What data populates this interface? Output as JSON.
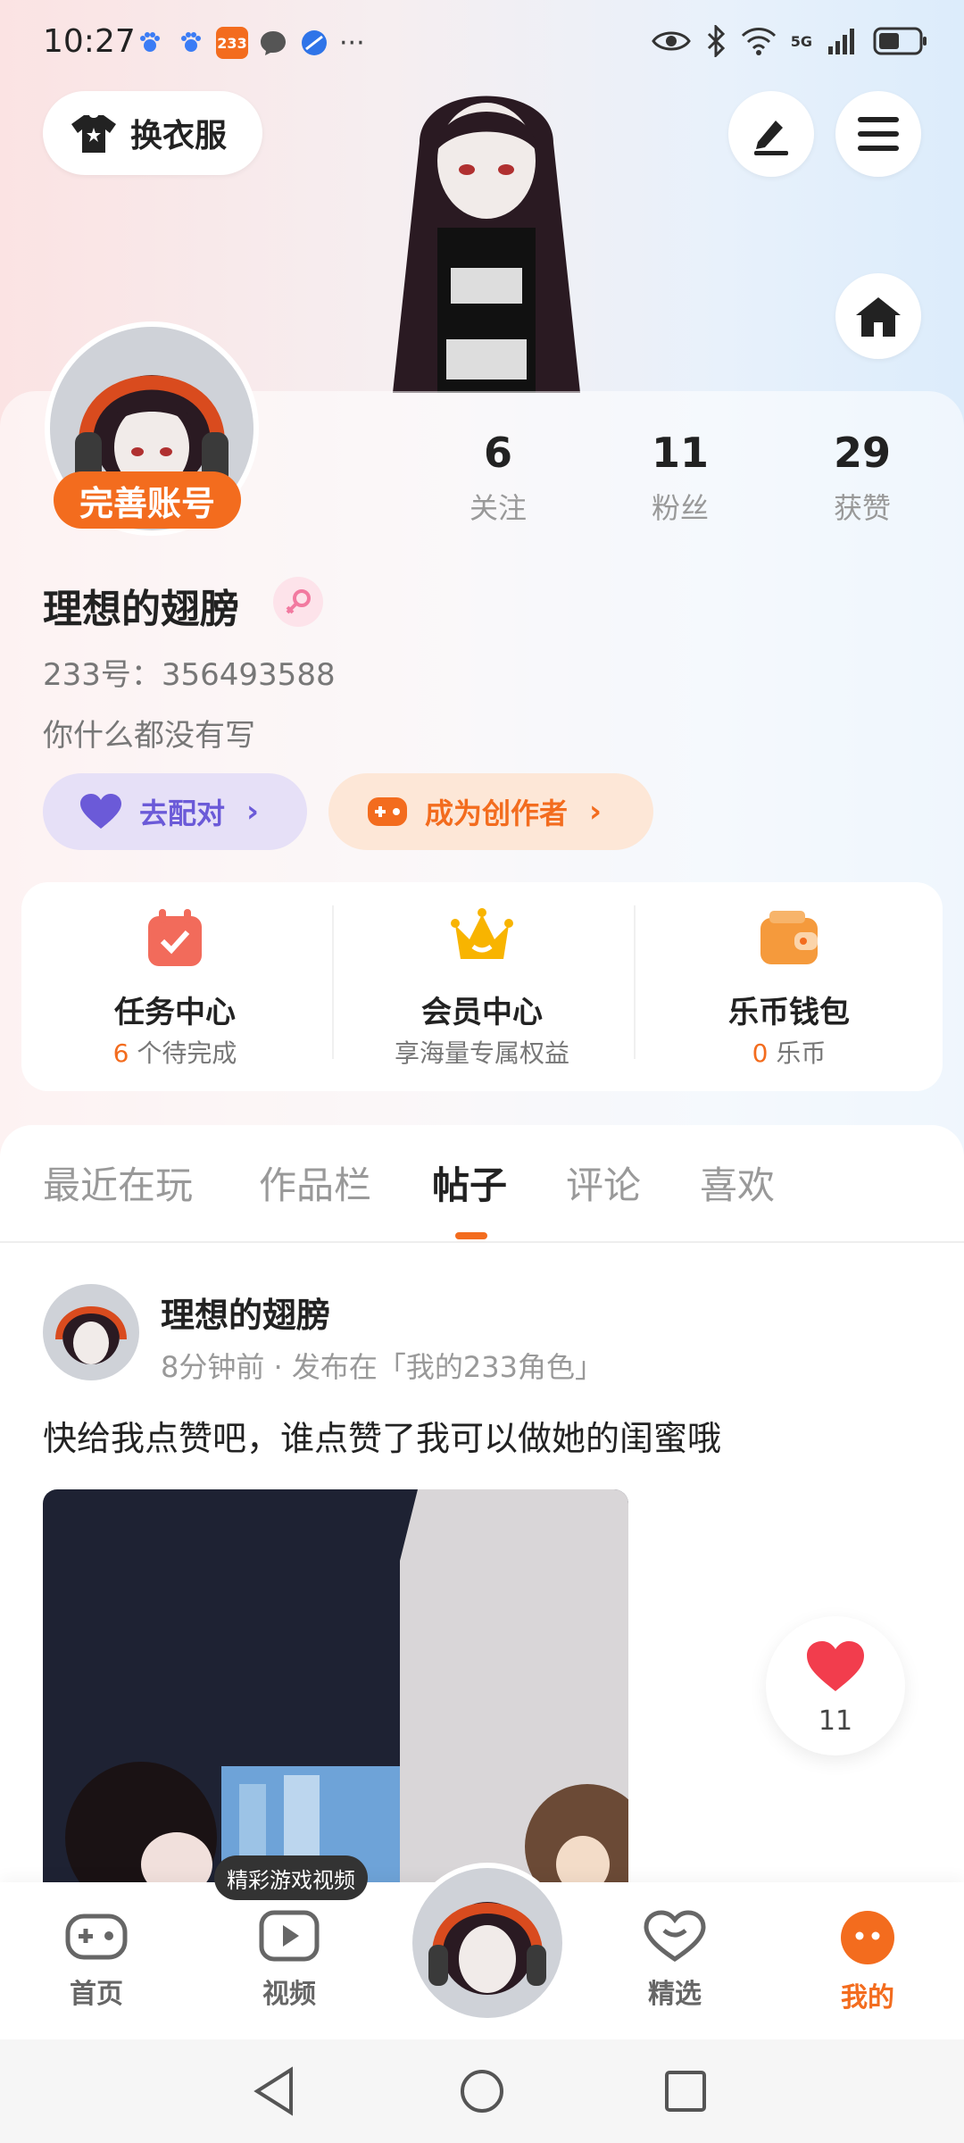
{
  "status_bar": {
    "time": "10:27",
    "notif_icons": [
      "paw-icon",
      "paw-icon",
      "233-app-icon",
      "chat-icon",
      "browser-icon"
    ],
    "app_badge_text": "233",
    "more": "···",
    "network": "5G",
    "system_icons": [
      "eye-icon",
      "bluetooth-icon",
      "wifi-icon",
      "signal-icon",
      "battery-icon"
    ]
  },
  "header": {
    "outfit_button": "换衣服",
    "edit_icon": "edit-icon",
    "menu_icon": "menu-icon",
    "home_icon": "home-icon"
  },
  "profile": {
    "complete_badge": "完善账号",
    "stats": [
      {
        "num": "6",
        "label": "关注"
      },
      {
        "num": "11",
        "label": "粉丝"
      },
      {
        "num": "29",
        "label": "获赞"
      }
    ],
    "username": "理想的翅膀",
    "gender_icon": "female-icon",
    "uid": "233号：356493588",
    "bio": "你什么都没有写",
    "match_button": "去配对",
    "creator_button": "成为创作者"
  },
  "services": [
    {
      "title": "任务中心",
      "sub_num": "6",
      "sub_text": " 个待完成",
      "icon": "calendar-check-icon"
    },
    {
      "title": "会员中心",
      "sub_num": "",
      "sub_text": "享海量专属权益",
      "icon": "crown-icon"
    },
    {
      "title": "乐币钱包",
      "sub_num": "0",
      "sub_text": " 乐币",
      "icon": "wallet-icon"
    }
  ],
  "tabs": [
    "最近在玩",
    "作品栏",
    "帖子",
    "评论",
    "喜欢"
  ],
  "active_tab": "帖子",
  "post": {
    "author": "理想的翅膀",
    "meta": "8分钟前 · 发布在「我的233角色」",
    "text": "快给我点赞吧，谁点赞了我可以做她的闺蜜哦",
    "likes": "11"
  },
  "bottom_nav": {
    "items": [
      "首页",
      "视频",
      "精选",
      "我的"
    ],
    "tooltip": "精彩游戏视频"
  },
  "colors": {
    "accent": "#f36c1e",
    "purple_pill": "#e6e0f7",
    "orange_pill": "#fde7d7"
  }
}
